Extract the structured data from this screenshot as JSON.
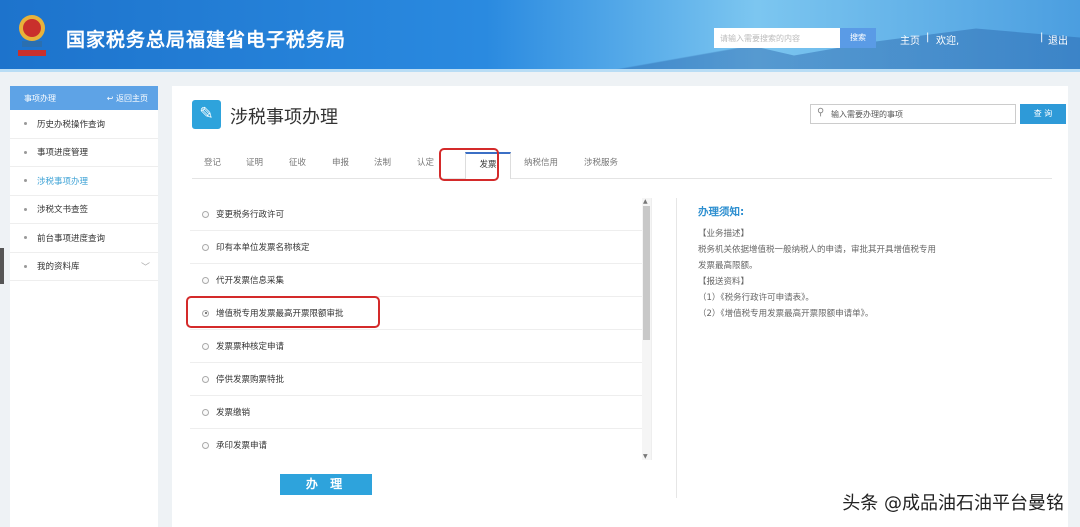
{
  "header": {
    "title": "国家税务总局福建省电子税务局",
    "search_placeholder": "请输入需要搜索的内容",
    "search_btn": "搜索",
    "home": "主页",
    "welcome": "欢迎,",
    "logout": "退出"
  },
  "sidebar": {
    "title": "事项办理",
    "back": "返回主页",
    "items": [
      {
        "label": "历史办税操作查询"
      },
      {
        "label": "事项进度管理"
      },
      {
        "label": "涉税事项办理"
      },
      {
        "label": "涉税文书查签"
      },
      {
        "label": "前台事项进度查询"
      },
      {
        "label": "我的资料库"
      }
    ]
  },
  "main": {
    "title": "涉税事项办理",
    "search_placeholder": "输入需要办理的事项",
    "search_btn": "查 询",
    "tabs": [
      "登记",
      "证明",
      "征收",
      "申报",
      "法制",
      "认定",
      "发票",
      "纳税信用",
      "涉税服务"
    ],
    "items": [
      "变更税务行政许可",
      "印有本单位发票名称核定",
      "代开发票信息采集",
      "增值税专用发票最高开票限额审批",
      "发票票种核定申请",
      "停供发票购票特批",
      "发票缴销",
      "承印发票申请"
    ],
    "submit": "办 理",
    "notes": {
      "title": "办理须知:",
      "l1": "【业务描述】",
      "l2": "税务机关依据增值税一般纳税人的申请，审批其开具增值税专用",
      "l3": "发票最高限额。",
      "l4": "【报送资料】",
      "l5": "（1）《税务行政许可申请表》。",
      "l6": "（2）《增值税专用发票最高开票限额申请单》。"
    }
  },
  "watermark": "头条 @成品油石油平台曼铭"
}
